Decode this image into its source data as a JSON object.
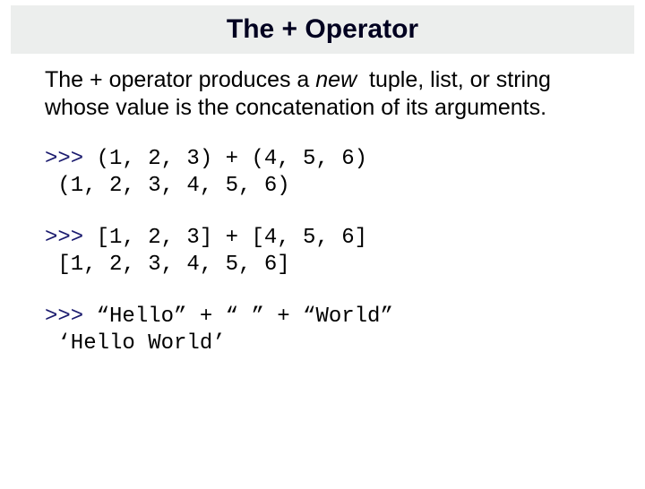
{
  "title": "The + Operator",
  "intro": {
    "segments": [
      {
        "text": "The + operator produces a ",
        "italic": false
      },
      {
        "text": "new",
        "italic": true
      },
      {
        "text": "  tuple, list, or string whose value is the concatenation of its arguments.",
        "italic": false
      }
    ]
  },
  "examples": [
    {
      "input_prefix": ">>> ",
      "input": "(1, 2, 3) + (4, 5, 6)",
      "output": " (1, 2, 3, 4, 5, 6)"
    },
    {
      "input_prefix": ">>> ",
      "input": "[1, 2, 3] + [4, 5, 6]",
      "output": " [1, 2, 3, 4, 5, 6]"
    },
    {
      "input_prefix": ">>> ",
      "input": "“Hello” + “ ” + “World”",
      "output": " ‘Hello World’"
    }
  ]
}
